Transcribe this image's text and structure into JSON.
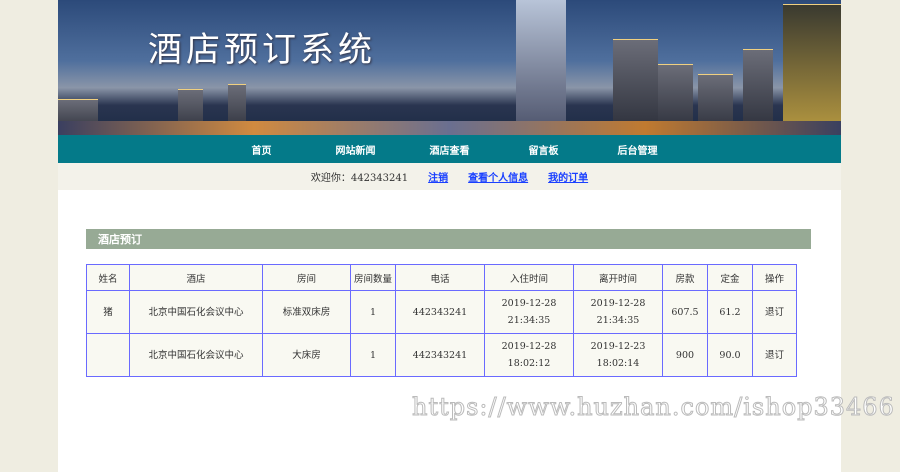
{
  "header": {
    "title": "酒店预订系统"
  },
  "nav": [
    "首页",
    "网站新闻",
    "酒店查看",
    "留言板",
    "后台管理"
  ],
  "welcome": {
    "text": "欢迎你：442343241",
    "logout": "注销",
    "profile": "查看个人信息",
    "orders": "我的订单"
  },
  "section": {
    "title": "酒店预订"
  },
  "table": {
    "headers": [
      "姓名",
      "酒店",
      "房间",
      "房间数量",
      "电话",
      "入住时间",
      "离开时间",
      "房款",
      "定金",
      "操作"
    ],
    "rows": [
      {
        "name": "猪",
        "hotel": "北京中国石化会议中心",
        "room": "标准双床房",
        "qty": "1",
        "phone": "442343241",
        "checkin_date": "2019-12-28",
        "checkin_time": "21:34:35",
        "checkout_date": "2019-12-28",
        "checkout_time": "21:34:35",
        "price": "607.5",
        "deposit": "61.2",
        "action": "退订"
      },
      {
        "name": "",
        "hotel": "北京中国石化会议中心",
        "room": "大床房",
        "qty": "1",
        "phone": "442343241",
        "checkin_date": "2019-12-28",
        "checkin_time": "18:02:12",
        "checkout_date": "2019-12-23",
        "checkout_time": "18:02:14",
        "price": "900",
        "deposit": "90.0",
        "action": "退订"
      }
    ]
  },
  "watermark": "https://www.huzhan.com/ishop33466"
}
